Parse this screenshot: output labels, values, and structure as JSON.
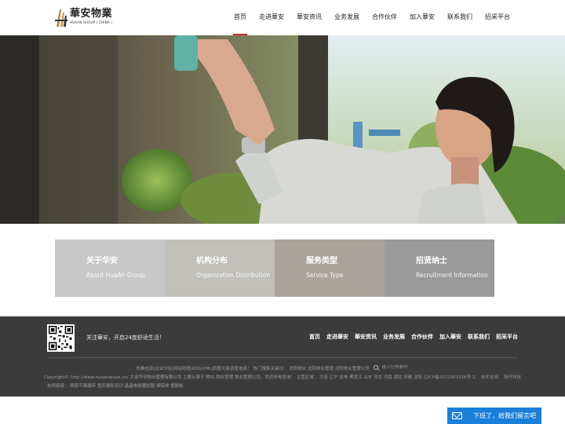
{
  "header": {
    "logo_cn": "華安物業",
    "logo_en": "HUAAN GROUP ( CHINA )",
    "nav": [
      "首页",
      "走进華安",
      "華安资讯",
      "业务发展",
      "合作伙伴",
      "加入華安",
      "联系我们",
      "招采平台"
    ],
    "active_index": 0,
    "accent_color": "#d7282f"
  },
  "cards": [
    {
      "title": "关于华安",
      "subtitle": "About HuaAn Group"
    },
    {
      "title": "机构分布",
      "subtitle": "Organization Distribution"
    },
    {
      "title": "服务类型",
      "subtitle": "Service Type"
    },
    {
      "title": "招贤纳士",
      "subtitle": "Recruitment Information"
    }
  ],
  "footer": {
    "follow_text": "关注華安，开启24度舒适生活！",
    "nav": [
      "首页",
      "走进華安",
      "華安资讯",
      "业务发展",
      "合作伙伴",
      "加入華安",
      "联系我们",
      "招采平台"
    ],
    "line1": "热推信息|企业分站|网站地图|RSS|XML|四暂无新调查信息！ 热门搜索关键词： 沈阳物业 沈阳物业管理 沈阳物业管理公司",
    "search_placeholder": "输入您想要的",
    "line2": "Copyright© http://www.huaanwuye.cn/ 大连华安物业管理有限公司 主要从事于 物业,物业管理,物业管理公司，欢迎来电咨询！ 主营区域： 大连 辽宁 吉林 黑龙江 山东 河北 河南 湖北 安徽 沈阳 辽ICP备2021003316号-2， 技术支持： 凯丹科技",
    "line3": "友情链接： 精密平面磨床 重庆摄影培训 晶晶电磁器加盟 钢铝排 塑胶板"
  },
  "message_button": {
    "label": "下班了，给我们留言吧",
    "color": "#1a7fd9"
  }
}
